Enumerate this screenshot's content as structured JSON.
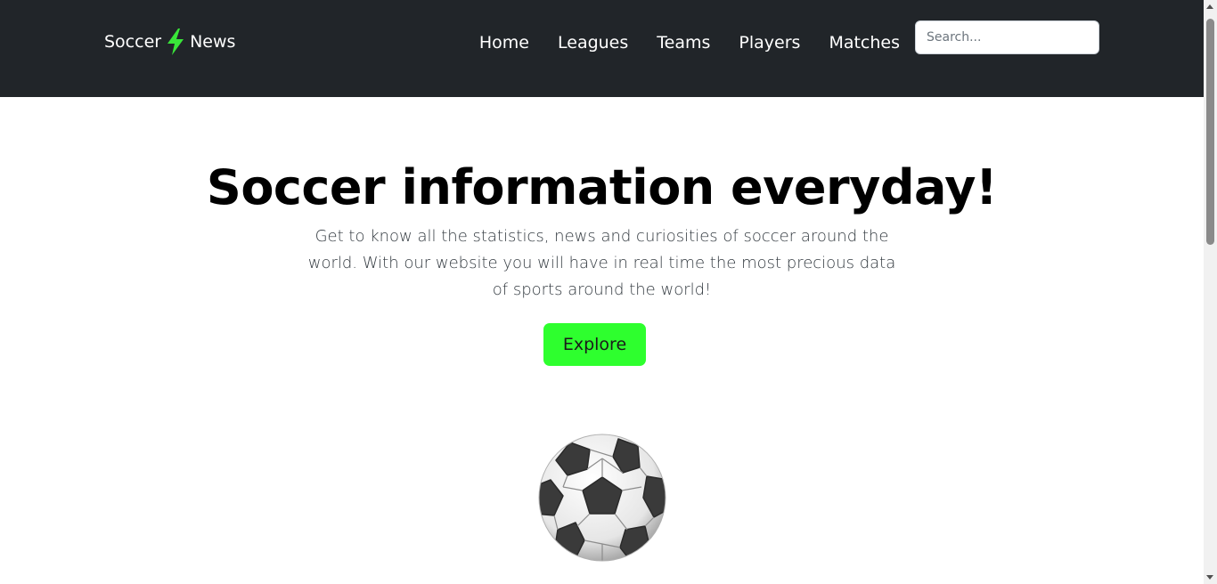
{
  "navbar": {
    "brand_left": "Soccer",
    "brand_right": "News",
    "brand_color": "#39e639",
    "links": [
      {
        "label": "Home"
      },
      {
        "label": "Leagues"
      },
      {
        "label": "Teams"
      },
      {
        "label": "Players"
      },
      {
        "label": "Matches"
      }
    ],
    "search_placeholder": "Search...",
    "background": "#212529"
  },
  "hero": {
    "title": "Soccer information everyday!",
    "text": "Get to know all the statistics, news and curiosities of soccer around the world. With our website you will have in real time the most precious data of sports around the world!",
    "button_label": "Explore",
    "button_color": "#2eff2e",
    "image_icon": "soccer-ball-icon"
  }
}
